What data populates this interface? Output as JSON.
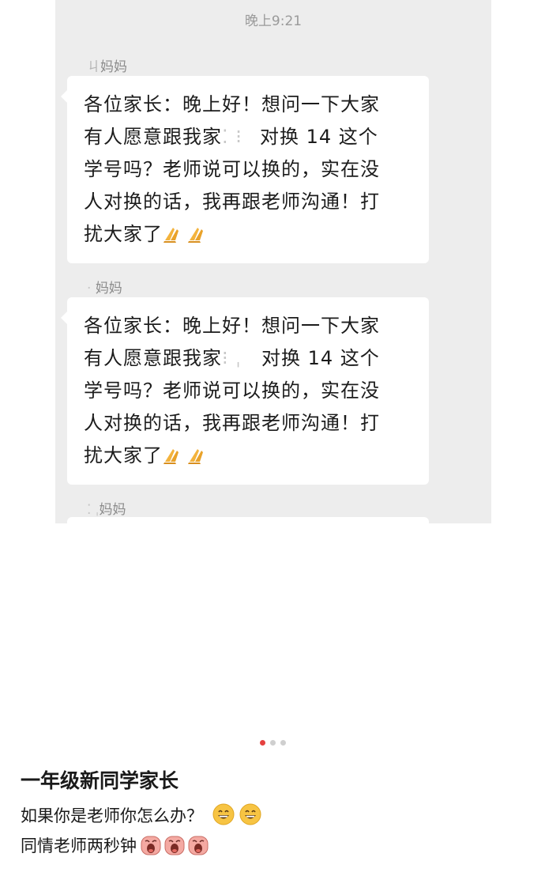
{
  "chat": {
    "timestamp": "晚上9:21",
    "messages": [
      {
        "sender": "妈妈",
        "lines": [
          "各位家长：晚上好！想问一下大家",
          "有人愿意跟我家",
          "对换 14 这个",
          "学号吗？老师说可以换的，实在没",
          "人对换的话，我再跟老师沟通！打",
          "扰大家了"
        ],
        "emoji": "pray-hands-icon"
      },
      {
        "sender": "妈妈",
        "lines": [
          "各位家长：晚上好！想问一下大家",
          "有人愿意跟我家",
          "对换 14 这个",
          "学号吗？老师说可以换的，实在没",
          "人对换的话，我再跟老师沟通！打",
          "扰大家了"
        ],
        "emoji": "pray-hands-icon"
      },
      {
        "sender": "妈妈"
      }
    ]
  },
  "carousel": {
    "total": 3,
    "active": 1,
    "active_color": "#e5413f",
    "inactive_color": "#cfcfcf"
  },
  "post": {
    "title": "一年级新同学家长",
    "line1": "如果你是老师你怎么办？",
    "line1_emoji": "grinning-face-icon",
    "line2": "同情老师两秒钟",
    "line2_emoji": "crying-face-icon"
  }
}
